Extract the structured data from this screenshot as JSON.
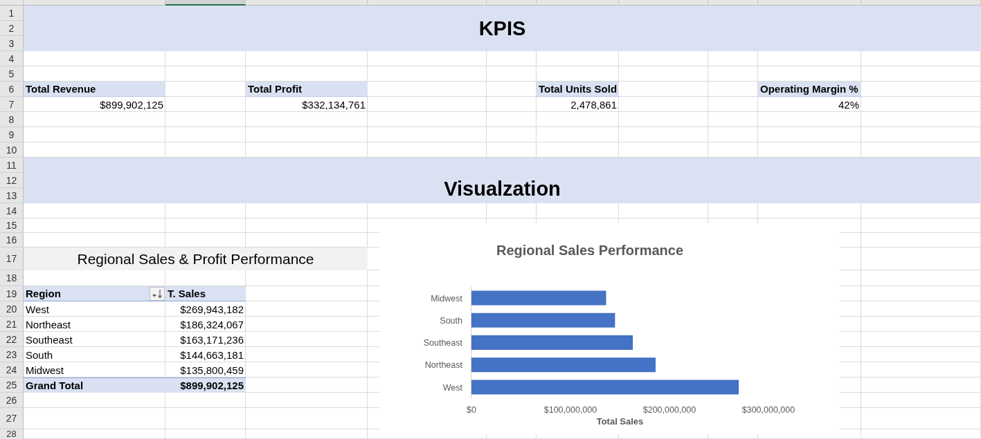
{
  "column_headers": [
    {
      "selected": false
    },
    {
      "selected": true
    },
    {
      "selected": false
    },
    {
      "selected": false
    },
    {
      "selected": false
    },
    {
      "selected": false
    },
    {
      "selected": false
    },
    {
      "selected": false
    },
    {
      "selected": false
    },
    {
      "selected": false
    }
  ],
  "row_numbers": [
    "1",
    "2",
    "3",
    "4",
    "5",
    "6",
    "7",
    "8",
    "9",
    "10",
    "11",
    "12",
    "13",
    "14",
    "15",
    "16",
    "17",
    "18",
    "19",
    "20",
    "21",
    "22",
    "23",
    "24",
    "25",
    "26",
    "27",
    "28"
  ],
  "kpi_banner": {
    "title": "KPIS"
  },
  "kpis": [
    {
      "label": "Total Revenue",
      "value": "$899,902,125"
    },
    {
      "label": "Total Profit",
      "value": "$332,134,761"
    },
    {
      "label": "Total Units Sold",
      "value": "2,478,861"
    },
    {
      "label": "Operating Margin %",
      "value": "42%"
    }
  ],
  "visualization_banner": {
    "title": "Visualzation"
  },
  "pivot_table": {
    "title": "Regional Sales & Profit Performance",
    "columns": [
      {
        "label": "Region",
        "filter": {
          "sorted": true
        }
      },
      {
        "label": "T. Sales"
      }
    ],
    "rows": [
      {
        "region": "West",
        "sales": "$269,943,182"
      },
      {
        "region": "Northeast",
        "sales": "$186,324,067"
      },
      {
        "region": "Southeast",
        "sales": "$163,171,236"
      },
      {
        "region": "South",
        "sales": "$144,663,181"
      },
      {
        "region": "Midwest",
        "sales": "$135,800,459"
      }
    ],
    "grand_total": {
      "label": "Grand Total",
      "value": "$899,902,125"
    }
  },
  "chart": {
    "chart_data": {
      "type": "bar",
      "orientation": "horizontal",
      "title": "Regional Sales Performance",
      "xlabel": "Total Sales",
      "categories": [
        "Midwest",
        "South",
        "Southeast",
        "Northeast",
        "West"
      ],
      "series": [
        {
          "color": "#4472c4",
          "values": [
            136000000,
            145000000,
            163000000,
            186000000,
            270000000
          ]
        }
      ],
      "xlim": [
        0,
        300000000
      ],
      "xticks": [
        {
          "value": 0,
          "label": "$0"
        },
        {
          "value": 100000000,
          "label": "$100,000,000"
        },
        {
          "value": 200000000,
          "label": "$200,000,000"
        },
        {
          "value": 300000000,
          "label": "$300,000,000"
        }
      ]
    }
  }
}
